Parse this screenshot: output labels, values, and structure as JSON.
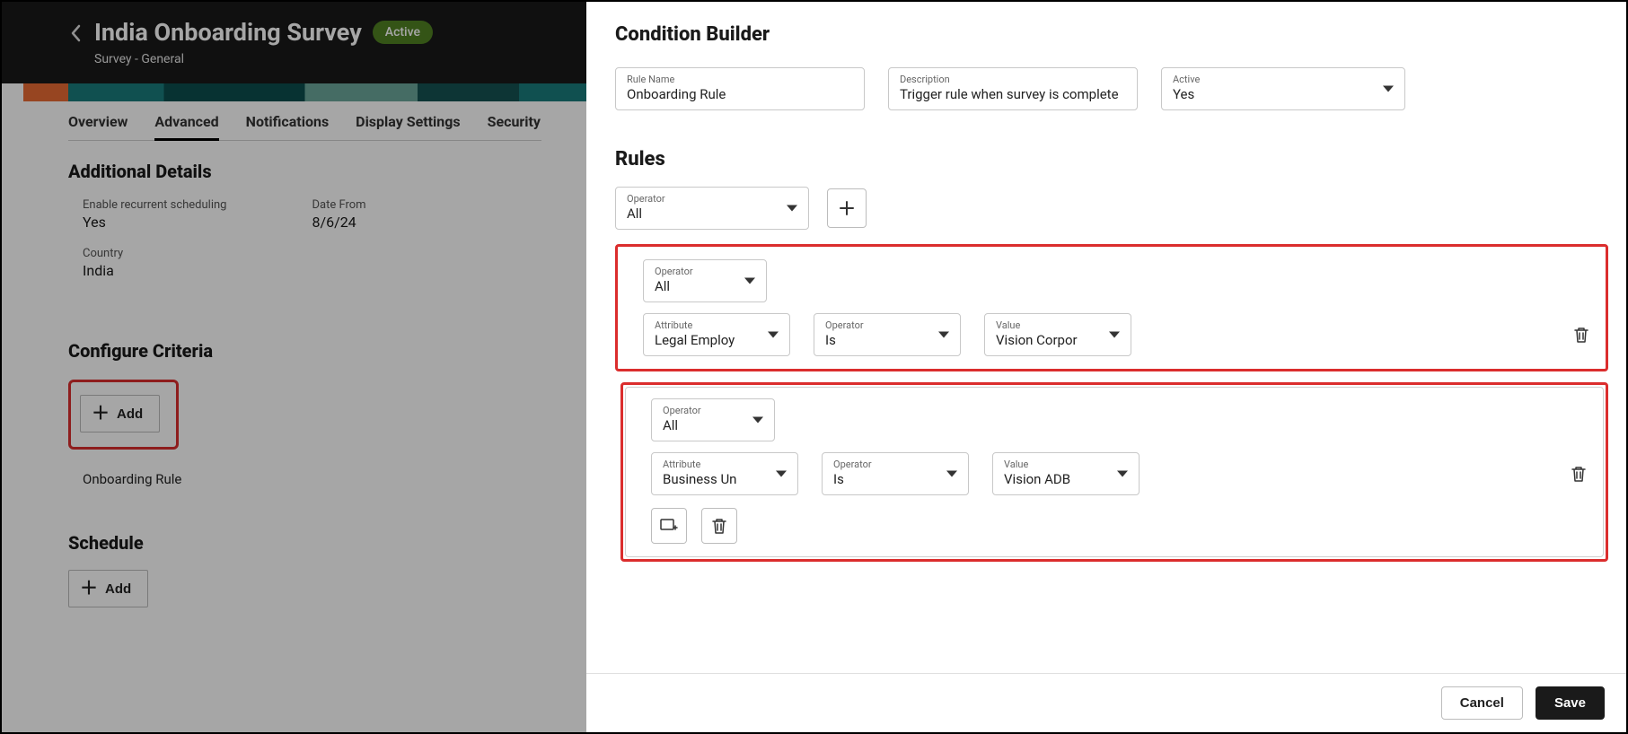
{
  "header": {
    "title": "India Onboarding Survey",
    "badge": "Active",
    "subtitle": "Survey - General"
  },
  "tabs": [
    "Overview",
    "Advanced",
    "Notifications",
    "Display Settings",
    "Security"
  ],
  "activeTab": "Advanced",
  "additionalDetails": {
    "heading": "Additional Details",
    "enableRecurrentLabel": "Enable recurrent scheduling",
    "enableRecurrentValue": "Yes",
    "countryLabel": "Country",
    "countryValue": "India",
    "dateFromLabel": "Date From",
    "dateFromValue": "8/6/24"
  },
  "configureCriteria": {
    "heading": "Configure Criteria",
    "addLabel": "Add",
    "ruleName": "Onboarding Rule"
  },
  "schedule": {
    "heading": "Schedule",
    "addLabel": "Add"
  },
  "conditionBuilder": {
    "title": "Condition Builder",
    "ruleNameLabel": "Rule Name",
    "ruleNameValue": "Onboarding Rule",
    "descriptionLabel": "Description",
    "descriptionValue": "Trigger rule when survey is complete",
    "activeLabel": "Active",
    "activeValue": "Yes",
    "rulesTitle": "Rules",
    "operatorLabel": "Operator",
    "operatorValue": "All",
    "attributeLabel": "Attribute",
    "valueLabel": "Value",
    "operatorInnerLabel": "Operator",
    "blocks": [
      {
        "operator": "All",
        "attribute": "Legal Employ",
        "conditionOperator": "Is",
        "value": "Vision Corpor"
      },
      {
        "operator": "All",
        "attribute": "Business Un",
        "conditionOperator": "Is",
        "value": "Vision ADB"
      }
    ]
  },
  "footer": {
    "cancel": "Cancel",
    "save": "Save"
  }
}
